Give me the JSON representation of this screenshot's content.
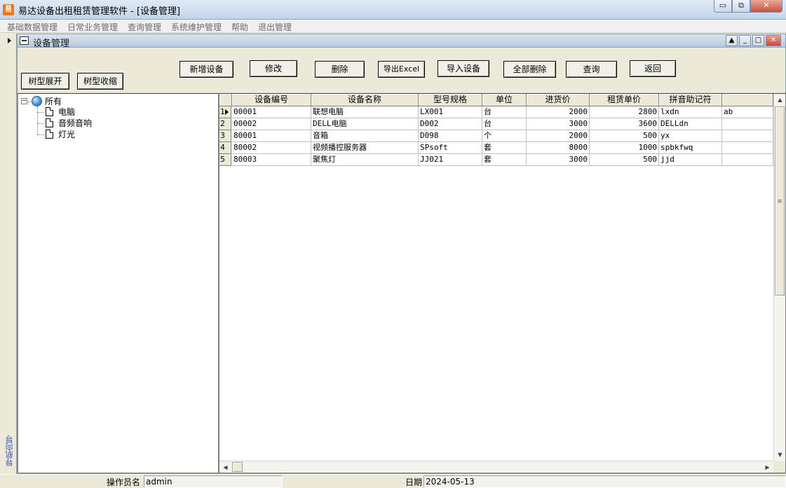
{
  "window": {
    "title": "易达设备出租租赁管理软件  - [设备管理]",
    "icon_char": "易",
    "min_glyph": "▭",
    "max_glyph": "⧉",
    "close_glyph": "✕"
  },
  "menu": [
    "基础数据管理",
    "日常业务管理",
    "查询管理",
    "系统维护管理",
    "帮助",
    "退出管理"
  ],
  "nav": {
    "label": "导航向导"
  },
  "child": {
    "title": "设备管理",
    "up_glyph": "▲",
    "min_glyph": "_",
    "max_glyph": "□",
    "close_glyph": "✕"
  },
  "toolbar": {
    "expand": "树型展开",
    "collapse": "树型收缩",
    "add": "新增设备",
    "edit": "修改",
    "delete": "删除",
    "export": "导出Excel",
    "import": "导入设备",
    "delete_all": "全部删除",
    "query": "查询",
    "back": "返回"
  },
  "tree": {
    "root": "所有",
    "root_toggle": "−",
    "children": [
      "电脑",
      "音频音响",
      "灯光"
    ]
  },
  "grid": {
    "columns": [
      "设备编号",
      "设备名称",
      "型号规格",
      "单位",
      "进货价",
      "租赁单价",
      "拼音助记符",
      ""
    ],
    "rows": [
      {
        "n": "1",
        "code": "00001",
        "name": "联想电脑",
        "model": "LX001",
        "unit": "台",
        "cost": "2000",
        "rent": "2800",
        "pinyin": "lxdn",
        "extra": "ab"
      },
      {
        "n": "2",
        "code": "00002",
        "name": "DELL电脑",
        "model": "D002",
        "unit": "台",
        "cost": "3000",
        "rent": "3600",
        "pinyin": "DELLdn",
        "extra": ""
      },
      {
        "n": "3",
        "code": "80001",
        "name": "音箱",
        "model": "D098",
        "unit": "个",
        "cost": "2000",
        "rent": "500",
        "pinyin": "yx",
        "extra": ""
      },
      {
        "n": "4",
        "code": "80002",
        "name": "视频播控服务器",
        "model": "SPsoft",
        "unit": "套",
        "cost": "8000",
        "rent": "1000",
        "pinyin": "spbkfwq",
        "extra": ""
      },
      {
        "n": "5",
        "code": "80003",
        "name": "聚焦灯",
        "model": "JJ021",
        "unit": "套",
        "cost": "3000",
        "rent": "500",
        "pinyin": "jjd",
        "extra": ""
      }
    ],
    "current_row": 1,
    "scroll": {
      "up": "▲",
      "down": "▼",
      "left": "◀",
      "right": "▶",
      "thumb_grip": "≡"
    }
  },
  "status": {
    "operator_label": "操作员名",
    "operator_value": "admin",
    "date_label": "日期",
    "date_value": "2024-05-13"
  }
}
